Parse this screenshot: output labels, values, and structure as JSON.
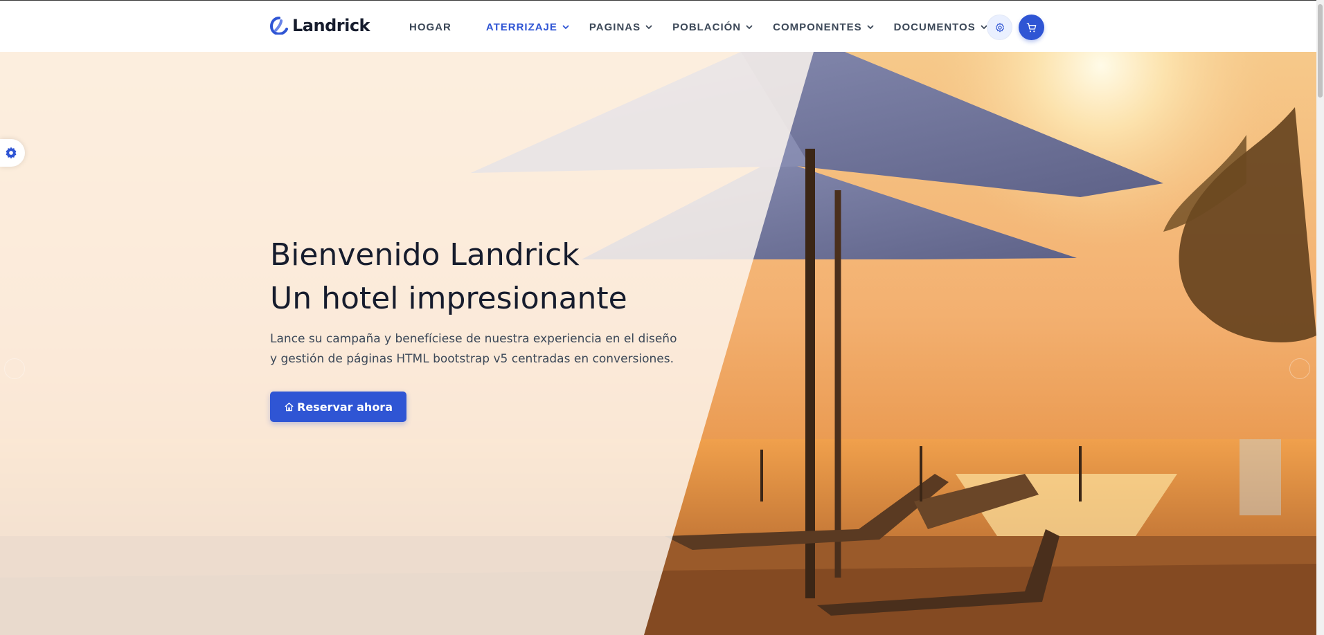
{
  "brand": {
    "name": "Landrick"
  },
  "nav": {
    "items": [
      {
        "label": "Hogar",
        "dropdown": false,
        "active": false
      },
      {
        "label": "Aterrizaje",
        "dropdown": true,
        "active": true
      },
      {
        "label": "Paginas",
        "dropdown": true,
        "active": false
      },
      {
        "label": "Población",
        "dropdown": true,
        "active": false
      },
      {
        "label": "Componentes",
        "dropdown": true,
        "active": false
      },
      {
        "label": "Documentos",
        "dropdown": true,
        "active": false
      }
    ],
    "settings_icon": "gear-icon",
    "cart_icon": "shopping-cart-icon"
  },
  "hero": {
    "title_line1": "Bienvenido Landrick",
    "title_line2": "Un hotel impresionante",
    "subtitle": "Lance su campaña y benefíciese de nuestra experiencia en el diseño y gestión de páginas HTML bootstrap v5 centradas en conversiones.",
    "cta_label": "Reservar ahora",
    "cta_icon": "home-icon"
  },
  "colors": {
    "primary": "#2f55d4",
    "heading": "#161c2d",
    "body_text": "#3c4858"
  }
}
